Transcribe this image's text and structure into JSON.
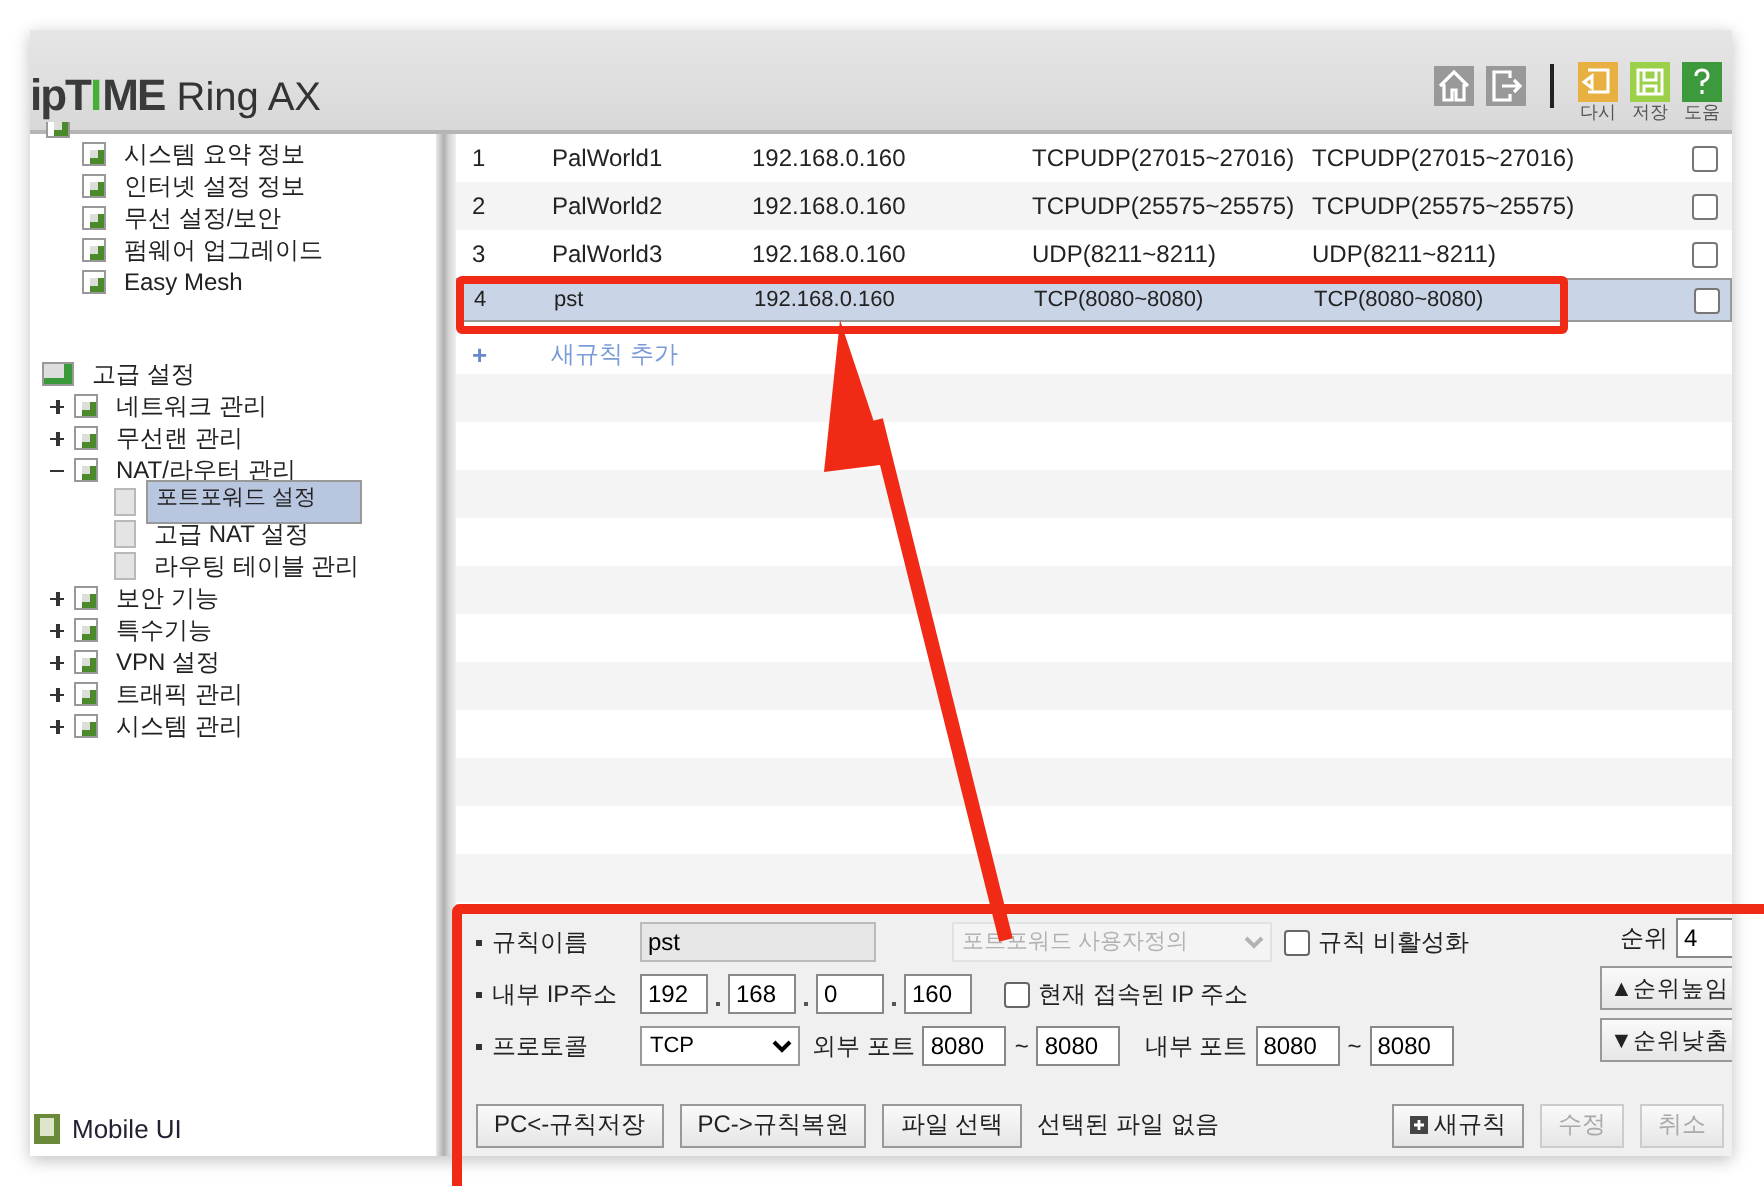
{
  "header": {
    "logo": {
      "lead": "ipT",
      "accent": "I",
      "tail": "ME",
      "model": "Ring AX"
    },
    "tools": [
      {
        "kind": "home"
      },
      {
        "kind": "logout"
      }
    ],
    "actions": [
      {
        "kind": "undo",
        "label": "다시"
      },
      {
        "kind": "save",
        "label": "저장"
      },
      {
        "kind": "help",
        "label": "도움"
      }
    ]
  },
  "sidebar": {
    "basic_items": [
      {
        "label": "시스템 요약 정보",
        "selected": false
      },
      {
        "label": "인터넷 설정 정보",
        "selected": false
      },
      {
        "label": "무선 설정/보안",
        "selected": false
      },
      {
        "label": "펌웨어 업그레이드",
        "selected": false
      },
      {
        "label": "Easy Mesh",
        "selected": false
      }
    ],
    "advanced": {
      "label": "고급 설정",
      "children": [
        {
          "label": "네트워크 관리",
          "expanded": false
        },
        {
          "label": "무선랜 관리",
          "expanded": false
        },
        {
          "label": "NAT/라우터 관리",
          "expanded": true,
          "children": [
            {
              "label": "포트포워드 설정",
              "selected": true
            },
            {
              "label": "고급 NAT 설정",
              "selected": false
            },
            {
              "label": "라우팅 테이블 관리",
              "selected": false
            }
          ]
        },
        {
          "label": "보안 기능",
          "expanded": false
        },
        {
          "label": "특수기능",
          "expanded": false
        },
        {
          "label": "VPN 설정",
          "expanded": false
        },
        {
          "label": "트래픽 관리",
          "expanded": false
        },
        {
          "label": "시스템 관리",
          "expanded": false
        }
      ]
    },
    "mobile_link": "Mobile UI"
  },
  "rules": [
    {
      "number": "1",
      "name": "PalWorld1",
      "ip": "192.168.0.160",
      "external": "TCPUDP(27015~27016)",
      "internal": "TCPUDP(27015~27016)",
      "checked": false,
      "selected": false
    },
    {
      "number": "2",
      "name": "PalWorld2",
      "ip": "192.168.0.160",
      "external": "TCPUDP(25575~25575)",
      "internal": "TCPUDP(25575~25575)",
      "checked": false,
      "selected": false
    },
    {
      "number": "3",
      "name": "PalWorld3",
      "ip": "192.168.0.160",
      "external": "UDP(8211~8211)",
      "internal": "UDP(8211~8211)",
      "checked": false,
      "selected": false
    },
    {
      "number": "4",
      "name": "pst",
      "ip": "192.168.0.160",
      "external": "TCP(8080~8080)",
      "internal": "TCP(8080~8080)",
      "checked": false,
      "selected": true
    }
  ],
  "add_rule": {
    "icon": "+",
    "label": "새규칙 추가"
  },
  "form": {
    "name_label": "규칙이름",
    "name_value": "pst",
    "preset_value": "포트포워드 사용자정의",
    "disable_label": "규칙 비활성화",
    "disable_checked": false,
    "ip_label": "내부 IP주소",
    "ip_parts": [
      "192",
      "168",
      "0",
      "160"
    ],
    "current_ip_label": "현재 접속된 IP 주소",
    "current_ip_checked": false,
    "protocol_label": "프로토콜",
    "protocol_value": "TCP",
    "ext_port_label": "외부 포트",
    "ext_from": "8080",
    "ext_to": "8080",
    "int_port_label": "내부 포트",
    "int_from": "8080",
    "int_to": "8080",
    "range_sep": "~",
    "priority_label": "순위",
    "priority_value": "4",
    "raise_button": "▲순위높임",
    "lower_button": "▼순위낮춤",
    "backup_button": "PC<-규칙저장",
    "restore_button": "PC->규칙복원",
    "file_button": "파일 선택",
    "file_status": "선택된 파일 없음",
    "buttons": [
      {
        "label": "새규칙",
        "kind": "new",
        "disabled": false
      },
      {
        "label": "수정",
        "kind": "plain",
        "disabled": true
      },
      {
        "label": "취소",
        "kind": "plain",
        "disabled": true
      }
    ]
  }
}
